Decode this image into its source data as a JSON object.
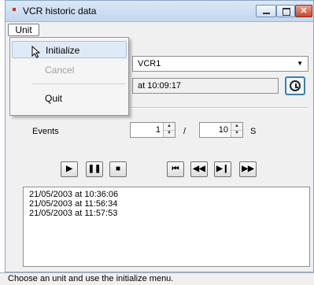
{
  "window": {
    "title": "VCR historic data"
  },
  "menubar": {
    "unit_label": "Unit"
  },
  "menu": {
    "items": [
      {
        "label": "Initialize",
        "enabled": true,
        "highlighted": true
      },
      {
        "label": "Cancel",
        "enabled": false
      },
      {
        "label": "Quit",
        "enabled": true
      }
    ]
  },
  "device": {
    "selected": "VCR1"
  },
  "date_field": {
    "value": "at 10:09:17"
  },
  "events": {
    "label": "Events",
    "current": "1",
    "separator": "/",
    "interval": "10",
    "unit": "S"
  },
  "playback": {
    "buttons": [
      "play-icon",
      "pause-icon",
      "stop-icon",
      "skip-start-icon",
      "rewind-icon",
      "step-forward-icon",
      "fast-forward-icon"
    ]
  },
  "log": {
    "lines": [
      "21/05/2003 at 10:36:06",
      "21/05/2003 at 11:56:34",
      "21/05/2003 at 11:57:53"
    ]
  },
  "status": {
    "text": "Choose an unit and use the initialize menu."
  },
  "colors": {
    "accent": "#3c7fb1",
    "close_button": "#c24a32",
    "menu_highlight": "#dfeaf7"
  }
}
